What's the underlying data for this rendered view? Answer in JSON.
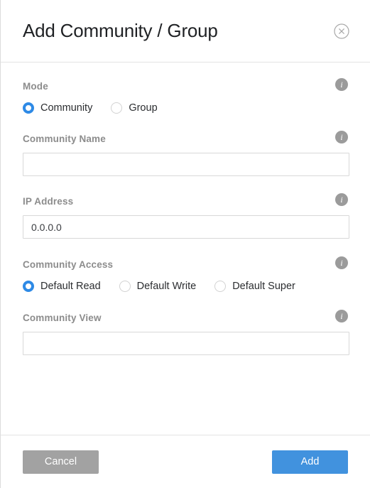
{
  "dialog": {
    "title": "Add Community / Group",
    "close_icon": "close-circle-icon"
  },
  "fields": {
    "mode": {
      "label": "Mode",
      "info_icon": "info-icon",
      "selected": "Community",
      "options": [
        "Community",
        "Group"
      ]
    },
    "community_name": {
      "label": "Community Name",
      "info_icon": "info-icon",
      "value": "",
      "placeholder": ""
    },
    "ip_address": {
      "label": "IP Address",
      "info_icon": "info-icon",
      "value": "0.0.0.0",
      "placeholder": ""
    },
    "community_access": {
      "label": "Community Access",
      "info_icon": "info-icon",
      "selected": "Default Read",
      "options": [
        "Default Read",
        "Default Write",
        "Default Super"
      ]
    },
    "community_view": {
      "label": "Community View",
      "info_icon": "info-icon",
      "value": "",
      "placeholder": ""
    }
  },
  "footer": {
    "cancel_label": "Cancel",
    "add_label": "Add"
  },
  "colors": {
    "accent_blue": "#4192de",
    "radio_blue": "#2e8ae6",
    "cancel_gray": "#a2a2a2",
    "label_gray": "#8c8c8c",
    "info_gray": "#9b9b9b",
    "border_gray": "#d8d8d8"
  }
}
